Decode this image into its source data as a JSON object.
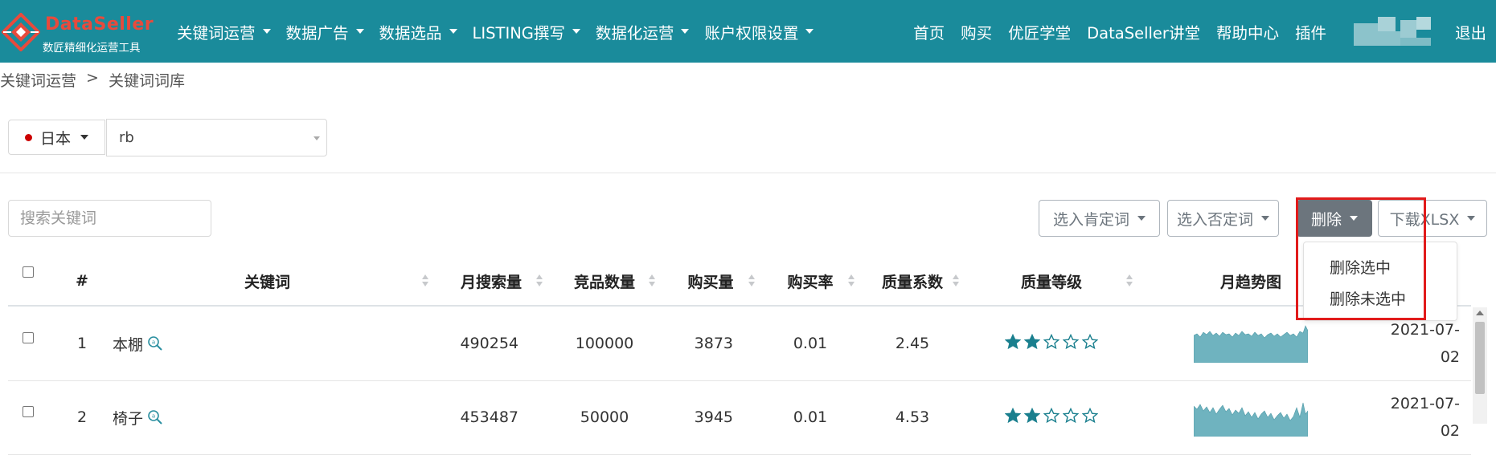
{
  "app": {
    "brand": "DataSeller",
    "tagline": "数匠精细化运营工具"
  },
  "nav": {
    "menus": [
      "关键词运营",
      "数据广告",
      "数据选品",
      "LISTING撰写",
      "数据化运营",
      "账户权限设置"
    ],
    "right_links": [
      "首页",
      "购买",
      "优匠学堂",
      "DataSeller讲堂",
      "帮助中心",
      "插件"
    ],
    "logout": "退出"
  },
  "breadcrumb": [
    "关键词运营",
    "关键词词库"
  ],
  "breadcrumb_sep": ">",
  "market": {
    "selected": "日本",
    "flag_color": "#cc0000"
  },
  "store": {
    "value": "rb"
  },
  "search": {
    "placeholder": "搜索关键词"
  },
  "actions": {
    "select_positive": "选入肯定词",
    "select_negative": "选入否定词",
    "delete": "删除",
    "download": "下载XLSX"
  },
  "delete_menu": [
    "删除选中",
    "删除未选中"
  ],
  "table": {
    "headers": {
      "index": "#",
      "keyword": "关键词",
      "monthly_search": "月搜索量",
      "competitors": "竞品数量",
      "purchases": "购买量",
      "purchase_rate": "购买率",
      "quality_factor": "质量系数",
      "quality_grade": "质量等级",
      "trend": "月趋势图"
    },
    "rows": [
      {
        "index": "1",
        "keyword": "本棚",
        "monthly_search": "490254",
        "competitors": "100000",
        "purchases": "3873",
        "purchase_rate": "0.01",
        "quality_factor": "2.45",
        "stars": 2,
        "date_line1": "2021-07-",
        "date_line2": "02"
      },
      {
        "index": "2",
        "keyword": "椅子",
        "monthly_search": "453487",
        "competitors": "50000",
        "purchases": "3945",
        "purchase_rate": "0.01",
        "quality_factor": "4.53",
        "stars": 2,
        "date_line1": "2021-07-",
        "date_line2": "02"
      }
    ]
  },
  "colors": {
    "nav_bg": "#1a8b9b",
    "brand_red": "#e84a3c",
    "star_fill": "#1a7f8e",
    "trend_fill": "#6fb3bf",
    "highlight": "#e11b1b"
  }
}
